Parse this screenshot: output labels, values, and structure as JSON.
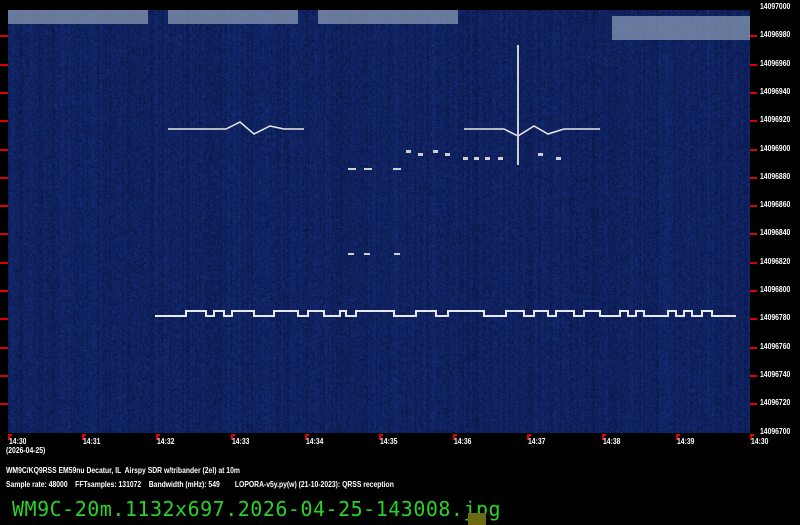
{
  "y_axis": {
    "labels": [
      "14097000",
      "14096980",
      "14096960",
      "14096940",
      "14096920",
      "14096900",
      "14096880",
      "14096860",
      "14096840",
      "14096820",
      "14096800",
      "14096780",
      "14096760",
      "14096740",
      "14096720",
      "14096700"
    ]
  },
  "x_axis": {
    "labels": [
      "14:30",
      "14:31",
      "14:32",
      "14:33",
      "14:34",
      "14:35",
      "14:36",
      "14:37",
      "14:38",
      "14:39",
      "14:30"
    ],
    "date": "(2026-04-25)"
  },
  "info": {
    "station": "WM9C/KQ9RSS EM59nu Decatur, IL  Airspy SDR w/tribander (2el) at 10m",
    "params": "Sample rate: 48000    FFTsamples: 131072    Bandwidth (mHz): 549        LOPORA-v5y.py(w) (21-10-2023): QRSS reception"
  },
  "filename": "WM9C-20m.1132x697.2026-04-25-143008.jpg",
  "colors": {
    "background": "#0c1a4a",
    "signal": "#ffffff",
    "tick": "#dd0000",
    "filename": "#2bd12b"
  }
}
